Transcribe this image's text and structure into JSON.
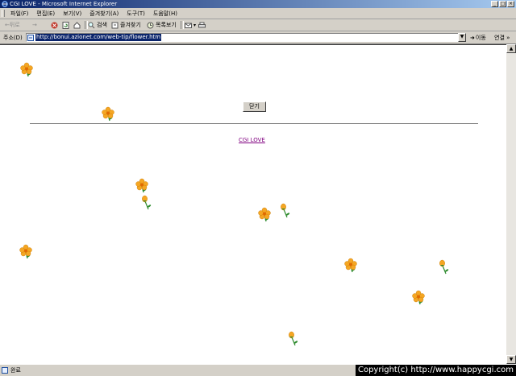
{
  "window": {
    "title": "CGI LOVE - Microsoft Internet Explorer"
  },
  "menu": [
    "파일(F)",
    "편집(E)",
    "보기(V)",
    "즐겨찾기(A)",
    "도구(T)",
    "도움말(H)"
  ],
  "toolbar": {
    "back": "←뒤로",
    "forward": "→",
    "search": "검색",
    "favorites": "즐겨찾기",
    "history": "목록보기"
  },
  "address": {
    "label": "주소(D)",
    "url": "http://bonui.azionet.com/web-tip/flower.htm",
    "go": "이동",
    "links": "연결 »"
  },
  "page": {
    "close_button": "닫기",
    "link": "CGI LOVE"
  },
  "status": {
    "text": "완료",
    "copyright": "Copyright(c) http://www.happycgi.com"
  },
  "flowers": [
    {
      "kind": "blossom"
    },
    {
      "kind": "blossom"
    },
    {
      "kind": "blossom"
    },
    {
      "kind": "bud"
    },
    {
      "kind": "blossom"
    },
    {
      "kind": "bud"
    },
    {
      "kind": "blossom"
    },
    {
      "kind": "blossom"
    },
    {
      "kind": "bud"
    },
    {
      "kind": "blossom"
    },
    {
      "kind": "bud"
    }
  ],
  "colors": {
    "title_start": "#0a246a",
    "title_end": "#a6caf0",
    "link_visited": "#800080",
    "petal": "#f5a623",
    "leaf": "#2e8b2e"
  }
}
